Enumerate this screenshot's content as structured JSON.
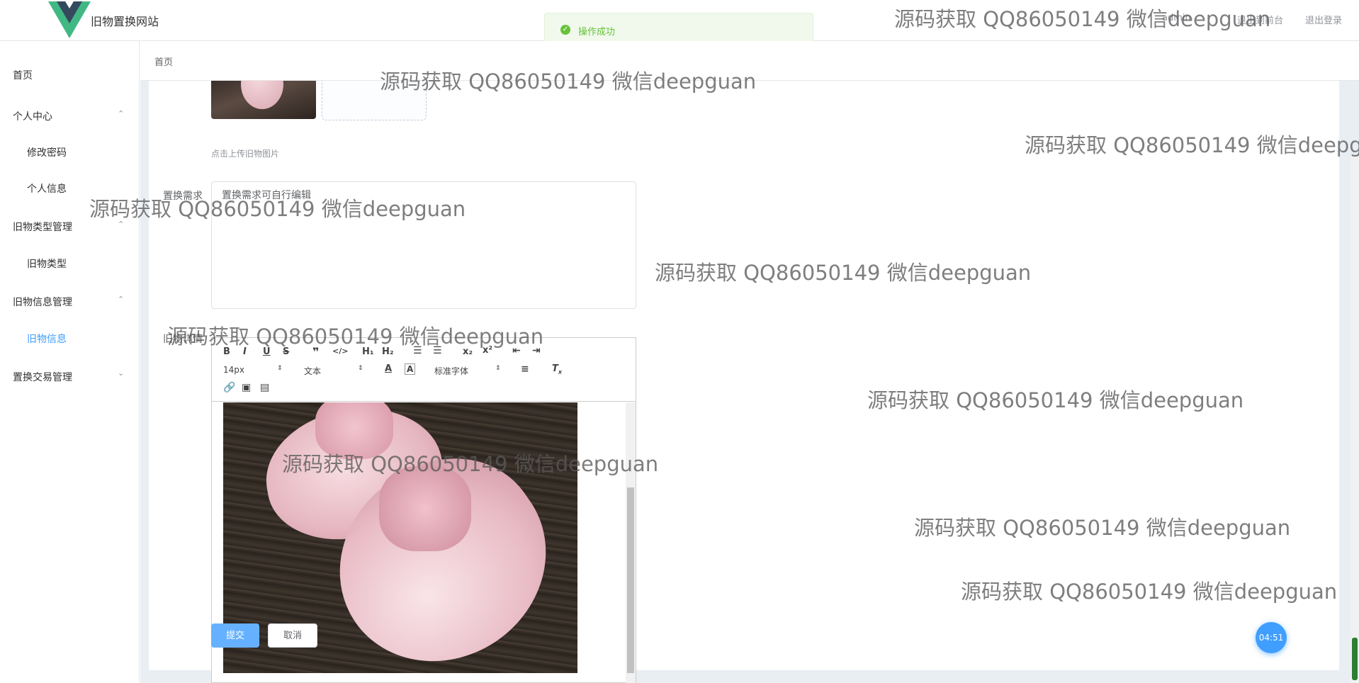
{
  "header": {
    "site_title": "旧物置换网站",
    "links": [
      "退出到前台",
      "退出登录"
    ],
    "link_partial": "admin"
  },
  "toast": {
    "text": "操作成功"
  },
  "sidebar": {
    "items": [
      {
        "label": "首页"
      },
      {
        "label": "个人中心",
        "children": [
          "修改密码",
          "个人信息"
        ]
      },
      {
        "label": "旧物类型管理",
        "children": [
          "旧物类型"
        ]
      },
      {
        "label": "旧物信息管理",
        "children": [
          "旧物信息"
        ]
      },
      {
        "label": "置换交易管理"
      }
    ],
    "active": "旧物信息"
  },
  "breadcrumb": "首页",
  "form": {
    "upload_tip": "点击上传旧物图片",
    "demand_label": "置换需求",
    "demand_value": "置换需求可自行编辑",
    "detail_label": "旧物详情",
    "editor": {
      "font_size": "14px",
      "text_type": "文本",
      "font_family": "标准字体"
    },
    "submit_label": "提交",
    "cancel_label": "取消"
  },
  "timer": "04:51",
  "watermark": "源码获取 QQ86050149 微信deepguan",
  "colors": {
    "primary": "#409eff",
    "success": "#67c23a",
    "active_menu": "#409eff"
  }
}
